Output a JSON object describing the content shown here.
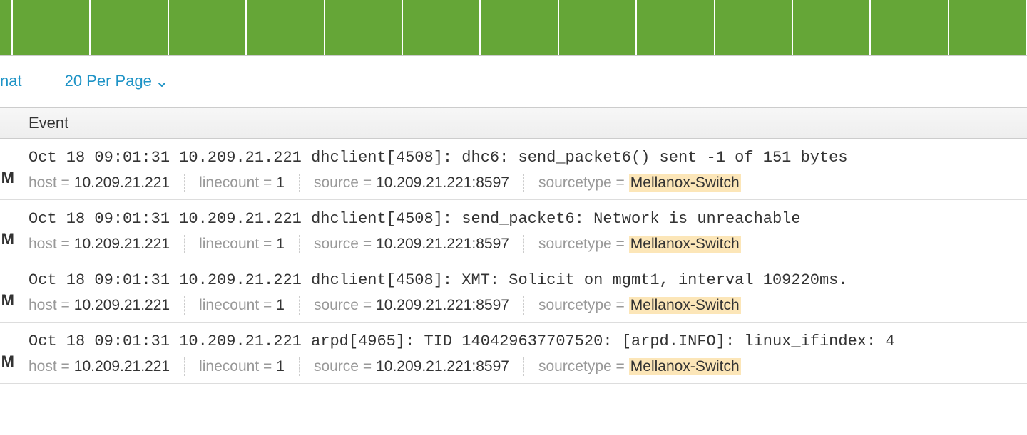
{
  "controls": {
    "format_label": "nat",
    "per_page_label": "20 Per Page"
  },
  "header": {
    "event_col": "Event",
    "side_marker": "M"
  },
  "meta_labels": {
    "host": "host",
    "linecount": "linecount",
    "source": "source",
    "sourcetype": "sourcetype",
    "eq": "="
  },
  "events": [
    {
      "raw": "Oct 18 09:01:31 10.209.21.221 dhclient[4508]: dhc6: send_packet6() sent -1 of 151 bytes",
      "host": "10.209.21.221",
      "linecount": "1",
      "source": "10.209.21.221:8597",
      "sourcetype": "Mellanox-Switch"
    },
    {
      "raw": "Oct 18 09:01:31 10.209.21.221 dhclient[4508]: send_packet6: Network is unreachable",
      "host": "10.209.21.221",
      "linecount": "1",
      "source": "10.209.21.221:8597",
      "sourcetype": "Mellanox-Switch"
    },
    {
      "raw": "Oct 18 09:01:31 10.209.21.221 dhclient[4508]: XMT: Solicit on mgmt1, interval 109220ms.",
      "host": "10.209.21.221",
      "linecount": "1",
      "source": "10.209.21.221:8597",
      "sourcetype": "Mellanox-Switch"
    },
    {
      "raw": "Oct 18 09:01:31 10.209.21.221 arpd[4965]: TID 140429637707520: [arpd.INFO]: linux_ifindex: 4",
      "host": "10.209.21.221",
      "linecount": "1",
      "source": "10.209.21.221:8597",
      "sourcetype": "Mellanox-Switch"
    }
  ],
  "timeline_cells": 14
}
